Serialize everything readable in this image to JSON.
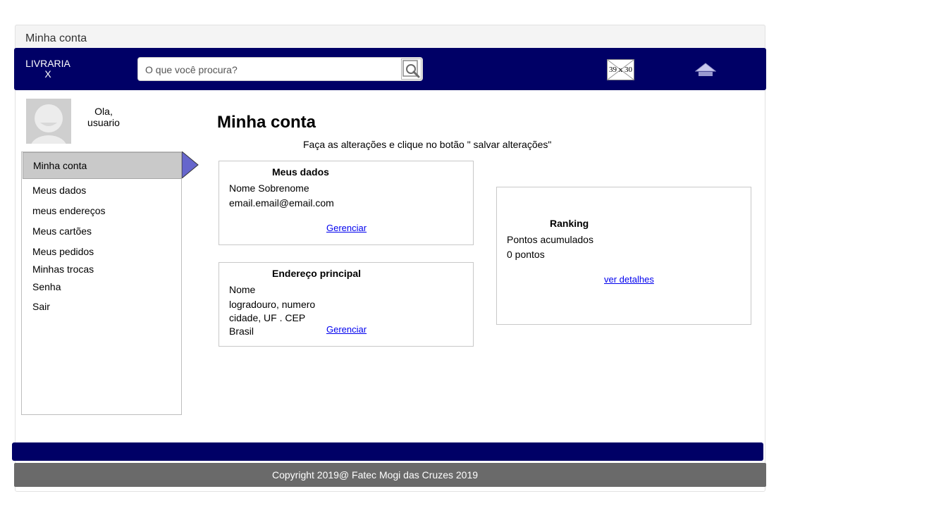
{
  "window": {
    "title": "Minha conta"
  },
  "header": {
    "logo_line1": "LIVRARIA",
    "logo_line2": "X",
    "search_placeholder": "O que você procura?",
    "image_placeholder_label": "39 x 30"
  },
  "user": {
    "greeting_line1": "Ola,",
    "greeting_line2": "usuario"
  },
  "sidebar": {
    "active_label": "Minha conta",
    "items": [
      {
        "label": "Meus dados"
      },
      {
        "label": "meus endereços"
      },
      {
        "label": "Meus cartões"
      },
      {
        "label": "Meus pedidos"
      },
      {
        "label": "Minhas trocas"
      },
      {
        "label": "Senha"
      },
      {
        "label": "Sair"
      }
    ]
  },
  "main": {
    "title": "Minha conta",
    "instructions": "Faça as alterações e clique no botão \" salvar alterações\"",
    "meus_dados": {
      "title": "Meus dados",
      "name": "Nome Sobrenome",
      "email": "email.email@email.com",
      "link": "Gerenciar"
    },
    "endereco": {
      "title": "Endereço principal",
      "name": "Nome",
      "street": "logradouro, numero",
      "city": "cidade, UF . CEP",
      "country": "Brasil",
      "link": "Gerenciar"
    },
    "ranking": {
      "title": "Ranking",
      "label": "Pontos acumulados",
      "points": "0 pontos",
      "link": "ver detalhes"
    }
  },
  "footer": {
    "copyright": "Copyright 2019@ Fatec Mogi das Cruzes 2019"
  },
  "colors": {
    "navbar": "#000066",
    "footer_gray": "#6a6a6a",
    "active_menu": "#c9c9c9",
    "arrow": "#6666cc",
    "link": "#0000ee"
  }
}
